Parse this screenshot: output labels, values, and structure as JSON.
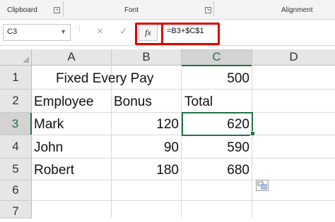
{
  "ribbon": {
    "groups": [
      "Clipboard",
      "Font",
      "Alignment"
    ]
  },
  "formula_bar": {
    "name_box": "C3",
    "cancel_icon": "×",
    "enter_icon": "✓",
    "fx_label": "fx",
    "formula": "=B3+$C$1"
  },
  "columns": [
    "A",
    "B",
    "C",
    "D"
  ],
  "rows": [
    "1",
    "2",
    "3",
    "4",
    "5",
    "6",
    "7"
  ],
  "cells": {
    "a1": "Fixed Every Pay",
    "c1": "500",
    "a2": "Employee",
    "b2": "Bonus",
    "c2": "Total",
    "a3": "Mark",
    "b3": "120",
    "c3": "620",
    "a4": "John",
    "b4": "90",
    "c4": "590",
    "a5": "Robert",
    "b5": "180",
    "c5": "680"
  },
  "selection": {
    "active_cell": "C3",
    "accent_color": "#217346",
    "highlight_color": "#e00000"
  }
}
